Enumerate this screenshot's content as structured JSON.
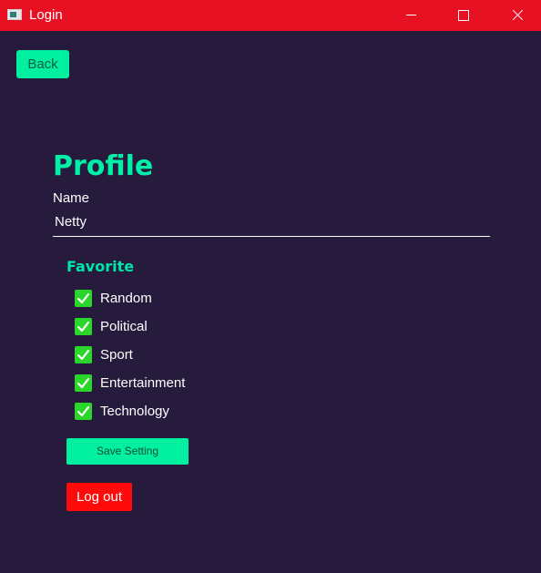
{
  "window": {
    "title": "Login",
    "app_icon": "window-app-icon",
    "controls": [
      "minimize-icon",
      "maximize-icon",
      "close-icon"
    ],
    "titlebar_color": "#e81123"
  },
  "nav": {
    "back_label": "Back"
  },
  "profile": {
    "heading": "Profile",
    "name_label": "Name",
    "name_value": "Netty"
  },
  "favorite": {
    "heading": "Favorite",
    "items": [
      {
        "label": "Random",
        "checked": true
      },
      {
        "label": "Political",
        "checked": true
      },
      {
        "label": "Sport",
        "checked": true
      },
      {
        "label": "Entertainment",
        "checked": true
      },
      {
        "label": "Technology",
        "checked": true
      }
    ]
  },
  "actions": {
    "save_label": "Save Setting",
    "logout_label": "Log out"
  },
  "colors": {
    "background": "#261a3d",
    "accent": "#00f0a0",
    "checkbox": "#2bd62b",
    "danger": "#ff0a0a"
  }
}
